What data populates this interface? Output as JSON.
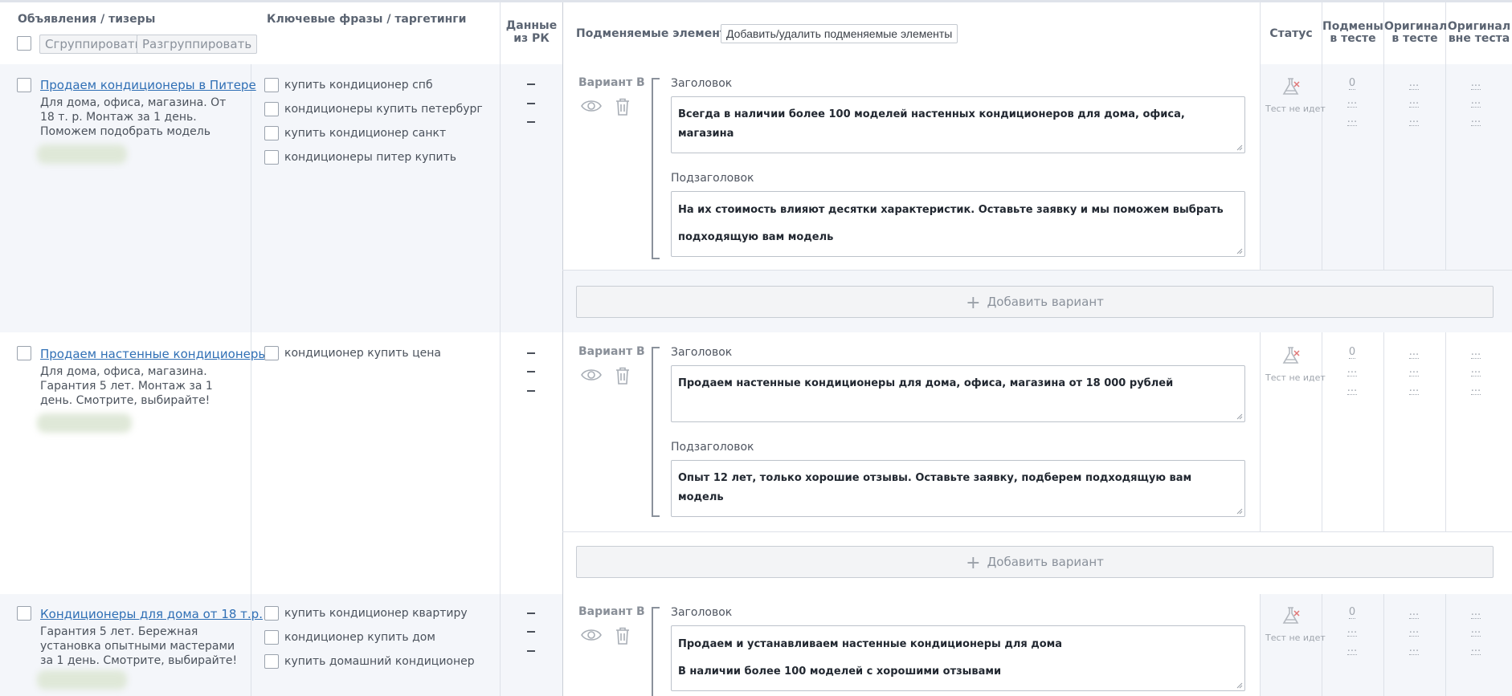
{
  "header": {
    "ads_title": "Объявления / тизеры",
    "group_label": "Сгруппировать",
    "ungroup_label": "Разгруппировать",
    "keywords_title": "Ключевые фразы / таргетинги",
    "campaign_data_line1": "Данные",
    "campaign_data_line2": "из РК",
    "replaced_title": "Подменяемые элементы",
    "add_remove_label": "Добавить/удалить подменяемые элементы",
    "status_title": "Статус",
    "replacements_line1": "Подмены",
    "replacements_line2": "в тесте",
    "original_test_line1": "Оригинал",
    "original_test_line2": "в тесте",
    "original_out_line1": "Оригинал",
    "original_out_line2": "вне теста"
  },
  "rows": [
    {
      "ad_title": "Продаем кондиционеры в Питере",
      "ad_desc": "Для дома, офиса, магазина. От 18 т. р. Монтаж за 1 день. Поможем подобрать модель",
      "keywords": [
        "купить кондиционер спб",
        "кондиционеры купить петербург",
        "купить кондиционер санкт",
        "кондиционеры питер купить"
      ],
      "variant_label": "Вариант B",
      "headline_label": "Заголовок",
      "headline_lines": [
        "Всегда в наличии более 100 моделей настенных кондиционеров для дома, офиса, магазина"
      ],
      "subheadline_label": "Подзаголовок",
      "subheadline_lines": [
        "На их стоимость влияют десятки характеристик. Оставьте заявку и мы поможем выбрать",
        "подходящую вам модель"
      ],
      "add_variant_label": "Добавить вариант",
      "status_text": "Тест не идет",
      "replacements": [
        "0",
        "...",
        "..."
      ],
      "original_in": [
        "...",
        "...",
        "..."
      ],
      "original_out": [
        "...",
        "...",
        "..."
      ]
    },
    {
      "ad_title": "Продаем настенные кондиционеры",
      "ad_desc": "Для дома, офиса, магазина. Гарантия 5 лет. Монтаж за 1 день. Смотрите, выбирайте!",
      "keywords": [
        "кондиционер купить цена"
      ],
      "variant_label": "Вариант B",
      "headline_label": "Заголовок",
      "headline_lines": [
        "Продаем настенные кондиционеры для дома, офиса, магазина от 18 000 рублей"
      ],
      "subheadline_label": "Подзаголовок",
      "subheadline_lines": [
        "Опыт 12 лет, только хорошие отзывы. Оставьте заявку, подберем подходящую вам модель"
      ],
      "add_variant_label": "Добавить вариант",
      "status_text": "Тест не идет",
      "replacements": [
        "0",
        "...",
        "..."
      ],
      "original_in": [
        "...",
        "...",
        "..."
      ],
      "original_out": [
        "...",
        "...",
        "..."
      ]
    },
    {
      "ad_title": "Кондиционеры для дома от 18 т.р.",
      "ad_desc": "Гарантия 5 лет. Бережная установка опытными мастерами за 1 день. Смотрите, выбирайте!",
      "keywords": [
        "купить кондиционер квартиру",
        "кондиционер купить дом",
        "купить домашний кондиционер"
      ],
      "variant_label": "Вариант B",
      "headline_label": "Заголовок",
      "headline_lines": [
        "Продаем и устанавливаем настенные кондиционеры для дома",
        "В наличии более 100 моделей с хорошими отзывами"
      ],
      "status_text": "Тест не идет",
      "replacements": [
        "0",
        "...",
        "..."
      ],
      "original_in": [
        "...",
        "...",
        "..."
      ],
      "original_out": [
        "...",
        "...",
        "..."
      ]
    }
  ]
}
